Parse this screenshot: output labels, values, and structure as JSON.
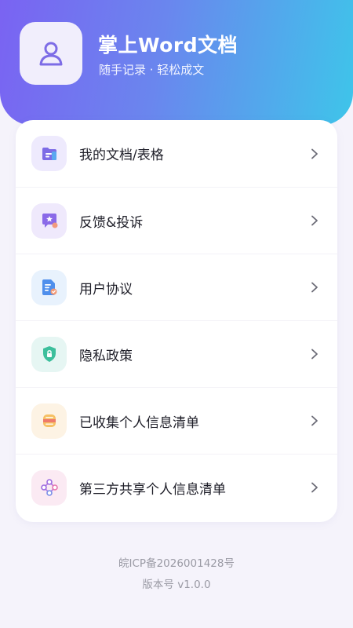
{
  "header": {
    "app_title": "掌上Word文档",
    "subtitle": "随手记录 · 轻松成文",
    "avatar_icon": "user-avatar-icon"
  },
  "menu": {
    "items": [
      {
        "label": "我的文档/表格",
        "icon": "document-folder-icon",
        "icon_bg": "#eeeafd"
      },
      {
        "label": "反馈&投诉",
        "icon": "feedback-star-icon",
        "icon_bg": "#efe9fc"
      },
      {
        "label": "用户协议",
        "icon": "agreement-document-icon",
        "icon_bg": "#e8f2fd"
      },
      {
        "label": "隐私政策",
        "icon": "privacy-shield-icon",
        "icon_bg": "#e6f6f3"
      },
      {
        "label": "已收集个人信息清单",
        "icon": "collected-info-icon",
        "icon_bg": "#fdf3e4"
      },
      {
        "label": "第三方共享个人信息清单",
        "icon": "third-party-share-icon",
        "icon_bg": "#fbeaf3"
      }
    ]
  },
  "footer": {
    "icp": "皖ICP备2026001428号",
    "version": "版本号 v1.0.0"
  },
  "colors": {
    "header_gradient_start": "#7a63f2",
    "header_gradient_end": "#3ec5ea",
    "page_background": "#f5f3fb",
    "chevron": "#6b6b76"
  }
}
